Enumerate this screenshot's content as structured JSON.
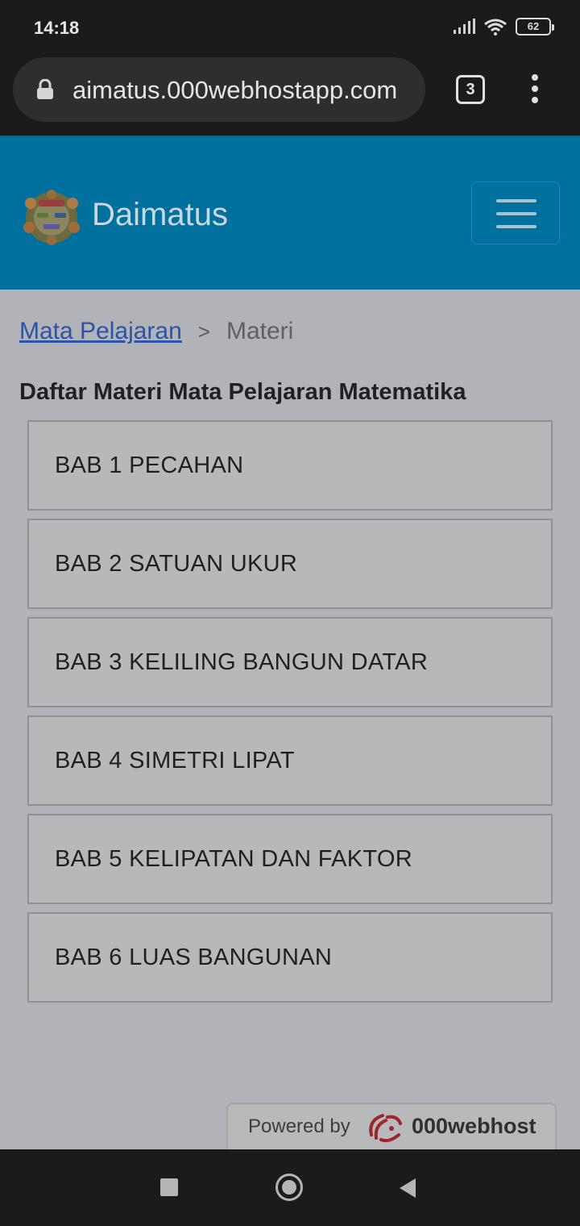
{
  "status_bar": {
    "time": "14:18",
    "battery": "62"
  },
  "browser": {
    "url": "aimatus.000webhostapp.com",
    "tab_count": "3"
  },
  "header": {
    "brand": "Daimatus"
  },
  "breadcrumb": {
    "parent": "Mata Pelajaran",
    "separator": ">",
    "current": "Materi"
  },
  "page": {
    "title": "Daftar Materi Mata Pelajaran Matematika"
  },
  "chapters": [
    "BAB 1 PECAHAN",
    "BAB 2 SATUAN UKUR",
    "BAB 3 KELILING BANGUN DATAR",
    "BAB 4 SIMETRI LIPAT",
    "BAB 5 KELIPATAN DAN FAKTOR",
    "BAB 6 LUAS BANGUNAN"
  ],
  "footer": {
    "powered_label": "Powered by",
    "host_name": "000webhost"
  },
  "colors": {
    "header": "#00709e",
    "body": "#b1b3b8",
    "link": "#2c54a6"
  }
}
